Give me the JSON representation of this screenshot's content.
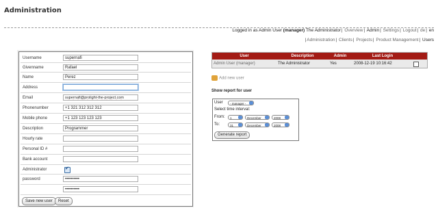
{
  "page": {
    "title": "Administration"
  },
  "header": {
    "login_prefix": "Logged in as Admin User",
    "login_role": "(manager)",
    "login_name": "The Administrator",
    "links": [
      "Overview",
      "Admin",
      "Settings",
      "Logout",
      "de",
      "en"
    ]
  },
  "subnav": {
    "items": [
      "Administration",
      "Clients",
      "Projects",
      "Product Management",
      "Users"
    ]
  },
  "form": {
    "fields": [
      {
        "label": "Username",
        "value": "supernafi"
      },
      {
        "label": "Givenname",
        "value": "Rafael"
      },
      {
        "label": "Name",
        "value": "Perez"
      },
      {
        "label": "Address",
        "value": ""
      },
      {
        "label": "Email",
        "value": "supernafi@prolight-the-project.com"
      },
      {
        "label": "Phonenumber",
        "value": "+1 321 312 312 312"
      },
      {
        "label": "Mobile phone",
        "value": "+1 123 123 123 123"
      },
      {
        "label": "Description",
        "value": "Programmer"
      },
      {
        "label": "Hourly rate",
        "value": ""
      },
      {
        "label": "Personal ID #",
        "value": ""
      },
      {
        "label": "Bank account",
        "value": ""
      },
      {
        "label": "Administrator",
        "value": ""
      },
      {
        "label": "password",
        "value": "••••••••••"
      },
      {
        "label": "",
        "value": "••••••••••"
      }
    ],
    "save_label": "Save new user",
    "reset_label": "Reset"
  },
  "users_table": {
    "headers": [
      "User",
      "Description",
      "Admin",
      "Last Login"
    ],
    "rows": [
      [
        "Admin User (manager)",
        "The Administrator",
        "Yes",
        "2008-12-19 10:16:42"
      ]
    ]
  },
  "add_user_label": "Add new user",
  "report": {
    "title": "Show report for user",
    "user_label": "User",
    "user_value": "- manager -",
    "interval_label": "Select time interval:",
    "from_label": "From:",
    "to_label": "To:",
    "from": {
      "day": "1",
      "month": "December",
      "year": "2008"
    },
    "to": {
      "day": "31",
      "month": "December",
      "year": "2008"
    },
    "generate_label": "Generate report"
  },
  "colors": {
    "header_red": "#a31b15",
    "row_gray": "#eaeaea"
  }
}
